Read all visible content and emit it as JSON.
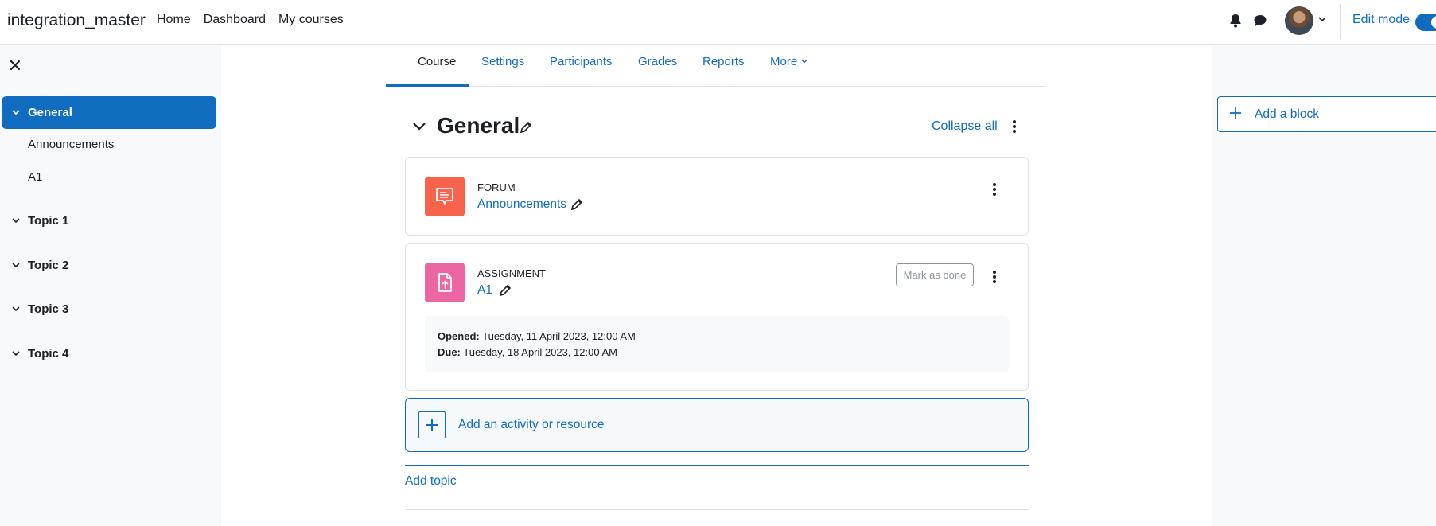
{
  "navbar": {
    "brand": "integration_master",
    "links": [
      "Home",
      "Dashboard",
      "My courses"
    ],
    "edit_mode_label": "Edit mode",
    "edit_mode_on": true
  },
  "drawer": {
    "items": [
      {
        "label": "General",
        "type": "section",
        "active": true
      },
      {
        "label": "Announcements",
        "type": "activity"
      },
      {
        "label": "A1",
        "type": "activity"
      },
      {
        "label": "Topic 1",
        "type": "section"
      },
      {
        "label": "Topic 2",
        "type": "section"
      },
      {
        "label": "Topic 3",
        "type": "section"
      },
      {
        "label": "Topic 4",
        "type": "section"
      }
    ]
  },
  "tabs": [
    "Course",
    "Settings",
    "Participants",
    "Grades",
    "Reports",
    "More"
  ],
  "section": {
    "title": "General",
    "collapse_label": "Collapse all"
  },
  "activities": [
    {
      "type": "Forum",
      "name": "Announcements",
      "color": "#f7634d"
    },
    {
      "type": "Assignment",
      "name": "A1",
      "color": "#eb66a2",
      "mark_done": "Mark as done",
      "opened_label": "Opened:",
      "opened_value": "Tuesday, 11 April 2023, 12:00 AM",
      "due_label": "Due:",
      "due_value": "Tuesday, 18 April 2023, 12:00 AM"
    }
  ],
  "add_activity_label": "Add an activity or resource",
  "add_topic_label": "Add topic",
  "block_drawer": {
    "add_block_label": "Add a block"
  },
  "colors": {
    "primary": "#0f6cbf",
    "text": "#1d2125",
    "drawer_bg": "#f8f9fa"
  }
}
